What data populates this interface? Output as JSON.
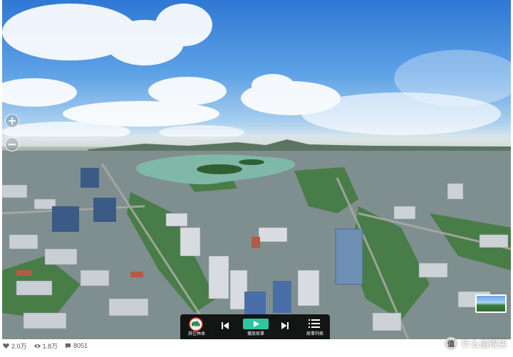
{
  "controls": {
    "story_label": "其它林本",
    "play_label": "播放故事",
    "list_label": "故事列表"
  },
  "stats": {
    "likes": "2.0万",
    "views": "1.8万",
    "comments": "8051"
  },
  "watermark": {
    "badge": "值",
    "text": "什么值得买"
  },
  "icons": {
    "zoom_in": "plus-icon",
    "zoom_out": "minus-icon",
    "prev": "skip-back-icon",
    "play": "play-icon",
    "next": "skip-forward-icon",
    "list": "list-icon",
    "story": "globe-avatar-icon",
    "likes": "heart-icon",
    "views": "eye-icon",
    "comments": "comment-icon"
  },
  "colors": {
    "accent": "#2cc6a0",
    "control_bar": "#0a0a0a"
  }
}
